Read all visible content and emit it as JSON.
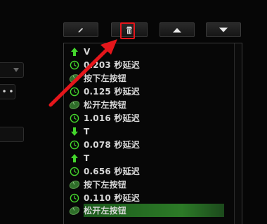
{
  "toolbar": {
    "edit_icon": "pencil-icon",
    "delete_icon": "trash-icon",
    "up_icon": "triangle-up-icon",
    "down_icon": "triangle-down-icon"
  },
  "macro_events": [
    {
      "type": "key-up",
      "icon": "green-up-arrow-icon",
      "text": "V"
    },
    {
      "type": "delay",
      "icon": "clock-icon",
      "text": "0.203 秒延迟"
    },
    {
      "type": "mouse",
      "icon": "mouse-icon",
      "text": "按下左按钮"
    },
    {
      "type": "delay",
      "icon": "clock-icon",
      "text": "0.125 秒延迟"
    },
    {
      "type": "mouse",
      "icon": "mouse-icon",
      "text": "松开左按钮"
    },
    {
      "type": "delay",
      "icon": "clock-icon",
      "text": "1.016 秒延迟"
    },
    {
      "type": "key-down",
      "icon": "green-down-arrow-icon",
      "text": "T"
    },
    {
      "type": "delay",
      "icon": "clock-icon",
      "text": "0.078 秒延迟"
    },
    {
      "type": "key-up",
      "icon": "green-up-arrow-icon",
      "text": "T"
    },
    {
      "type": "delay",
      "icon": "clock-icon",
      "text": "0.656 秒延迟"
    },
    {
      "type": "mouse",
      "icon": "mouse-icon",
      "text": "按下左按钮"
    },
    {
      "type": "delay",
      "icon": "clock-icon",
      "text": "0.110 秒延迟"
    },
    {
      "type": "mouse",
      "icon": "mouse-icon",
      "text": "松开左按钮",
      "selected": true
    }
  ],
  "colors": {
    "accent_green": "#44d62c",
    "selection_green": "#2c7a27",
    "annotation_red": "#e5161b"
  },
  "left_panel": {
    "dots_label": "• •"
  }
}
